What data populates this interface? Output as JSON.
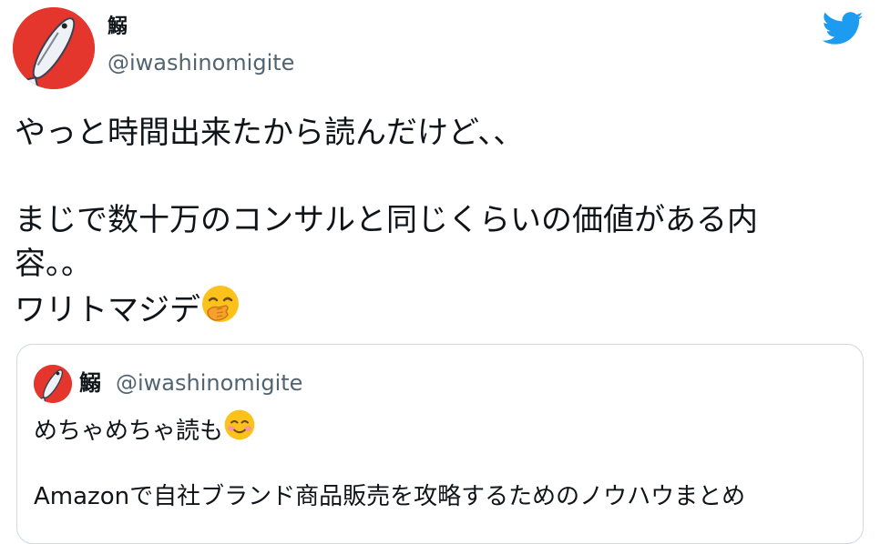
{
  "tweet": {
    "author": {
      "display_name": "鰯",
      "handle": "@iwashinomigite"
    },
    "brand_icon": "twitter-bird-icon",
    "text_lines": [
      "やっと時間出来たから読んだけど、、",
      "",
      "まじで数十万のコンサルと同じくらいの価値がある内",
      "容。。",
      "ワリトマジデ"
    ],
    "end_emoji": "face-with-hand-over-mouth-emoji"
  },
  "quoted_tweet": {
    "author": {
      "display_name": "鰯",
      "handle": "@iwashinomigite"
    },
    "text_lines": [
      "めちゃめちゃ読も",
      "",
      "Amazonで自社ブランド商品販売を攻略するためのノウハウまとめ"
    ],
    "end_emoji": "smiling-face-emoji"
  },
  "colors": {
    "brand_blue": "#1d9bf0",
    "avatar_red": "#e4362c",
    "handle_gray": "#536471",
    "border": "#cfd9de"
  }
}
